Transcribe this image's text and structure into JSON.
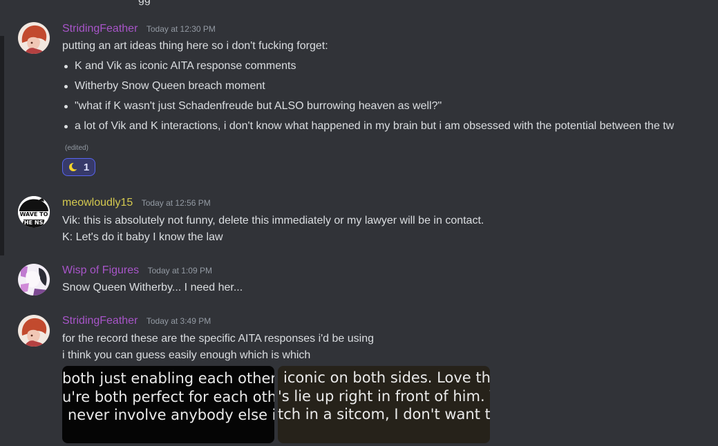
{
  "top_fragment": "gg",
  "messages": [
    {
      "username": "StridingFeather",
      "username_color": "#a855c9",
      "timestamp": "Today at 12:30 PM",
      "text": "putting an art ideas thing here so i don't fucking forget:",
      "bullets": [
        "K and Vik as iconic AITA response comments",
        "Witherby Snow Queen breach moment",
        "\"what if K wasn't just Schadenfreude but ALSO burrowing heaven as well?\"",
        "a lot of Vik and K interactions, i don't know what happened in my brain but i am obsessed with the potential between the tw"
      ],
      "edited": "(edited)",
      "reaction": {
        "emoji": "crescent-moon-icon",
        "count": "1"
      }
    },
    {
      "username": "meowloudly15",
      "username_color": "#d4c94f",
      "timestamp": "Today at 12:56 PM",
      "avatar_text": [
        "WAVE TO",
        "THE NSA"
      ],
      "lines": [
        "Vik: this is absolutely not funny, delete this immediately or my lawyer will be in contact.",
        "K: Let's do it baby I know the law"
      ]
    },
    {
      "username": "Wisp of Figures",
      "username_color": "#a855c9",
      "timestamp": "Today at 1:09 PM",
      "lines": [
        "Snow Queen Witherby... I need her..."
      ]
    },
    {
      "username": "StridingFeather",
      "username_color": "#a855c9",
      "timestamp": "Today at 3:49 PM",
      "lines": [
        "for the record these are the specific AITA responses i'd be using",
        "i think you can guess easily enough which is which"
      ],
      "images": [
        {
          "lines": [
            "both just enabling each other's",
            "u're both perfect for each other",
            "never involve anybody else in"
          ]
        },
        {
          "lines": [
            "iconic on both sides. Love the",
            "'s lie up right in front of him. Yo",
            "tch in a sitcom, I don't want to k"
          ]
        }
      ]
    }
  ]
}
